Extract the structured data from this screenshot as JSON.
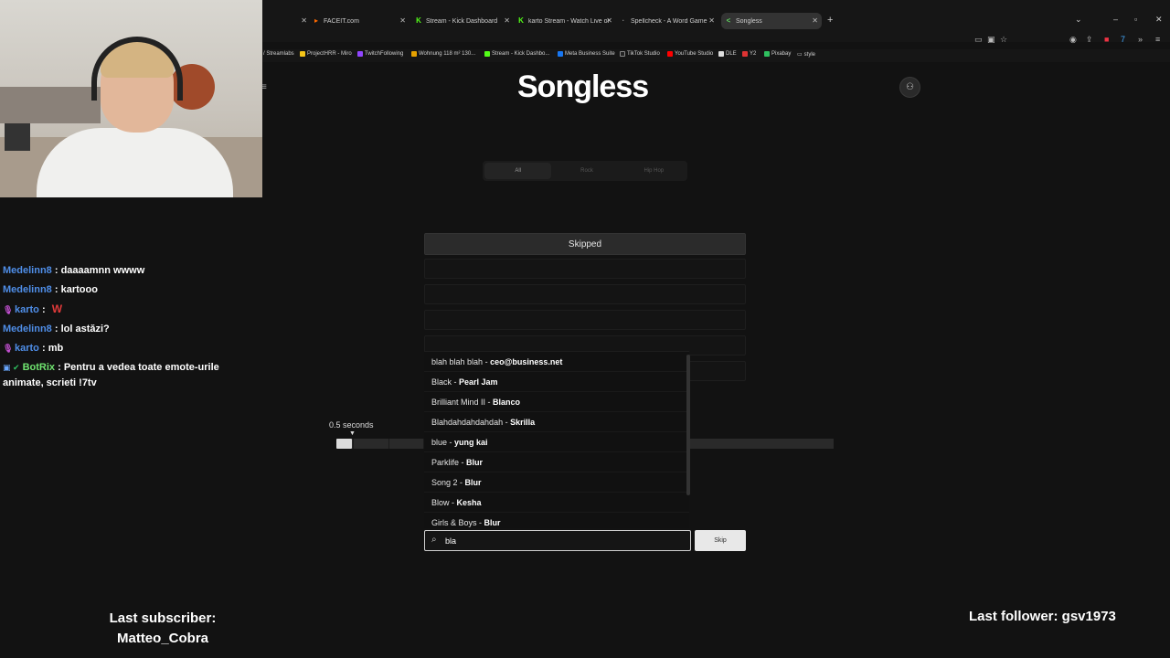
{
  "browser": {
    "tabs": [
      {
        "label": "FACEIT.com",
        "icon": "faceit-icon",
        "active": false
      },
      {
        "label": "Stream - Kick Dashboard",
        "icon": "kick-icon",
        "active": false
      },
      {
        "label": "karto Stream - Watch Live on K",
        "icon": "kick-icon",
        "active": false
      },
      {
        "label": "Spellcheck - A Word Game | R",
        "icon": "spellcheck-icon",
        "active": false
      },
      {
        "label": "Songless",
        "icon": "songless-icon",
        "active": true
      }
    ],
    "bookmarks": [
      "/ Streamlabs",
      "ProjectHRR - Miro",
      "TwitchFollowing",
      "Wohnung 118 m² 130...",
      "Stream - Kick Dashbo...",
      "Meta Business Suite",
      "TikTok Studio",
      "YouTube Studio",
      "DLE",
      "Y2",
      "Pixabay",
      "style"
    ]
  },
  "app": {
    "logo": "Songless",
    "genres": [
      "All",
      "Rock",
      "Hip Hop"
    ],
    "guess_status": "Skipped",
    "timeline_label": "0.5 seconds",
    "timeline_fraction": 0.031,
    "suggestions": [
      {
        "title": "blah blah blah",
        "artist": "ceo@business.net"
      },
      {
        "title": "Black",
        "artist": "Pearl Jam"
      },
      {
        "title": "Brilliant Mind II",
        "artist": "Blanco"
      },
      {
        "title": "Blahdahdahdahdah",
        "artist": "Skrilla"
      },
      {
        "title": "blue",
        "artist": "yung kai"
      },
      {
        "title": "Parklife",
        "artist": "Blur"
      },
      {
        "title": "Song 2",
        "artist": "Blur"
      },
      {
        "title": "Blow",
        "artist": "Kesha"
      },
      {
        "title": "Girls & Boys",
        "artist": "Blur"
      }
    ],
    "search_value": "bla",
    "skip_label": "Skip"
  },
  "chat": {
    "messages": [
      {
        "user": "Medelinn8",
        "text": "daaaamnn wwww"
      },
      {
        "user": "Medelinn8",
        "text": "kartooo"
      },
      {
        "user": "karto",
        "text": "W"
      },
      {
        "user": "Medelinn8",
        "text": "lol astăzi?"
      },
      {
        "user": "karto",
        "text": "mb"
      },
      {
        "user": "BotRix",
        "text": "Pentru a vedea toate emote-urile animate, scrieti !7tv"
      }
    ]
  },
  "overlay": {
    "last_subscriber_label": "Last subscriber:",
    "last_subscriber_name": "Matteo_Cobra",
    "last_follower": "Last follower: gsv1973"
  }
}
